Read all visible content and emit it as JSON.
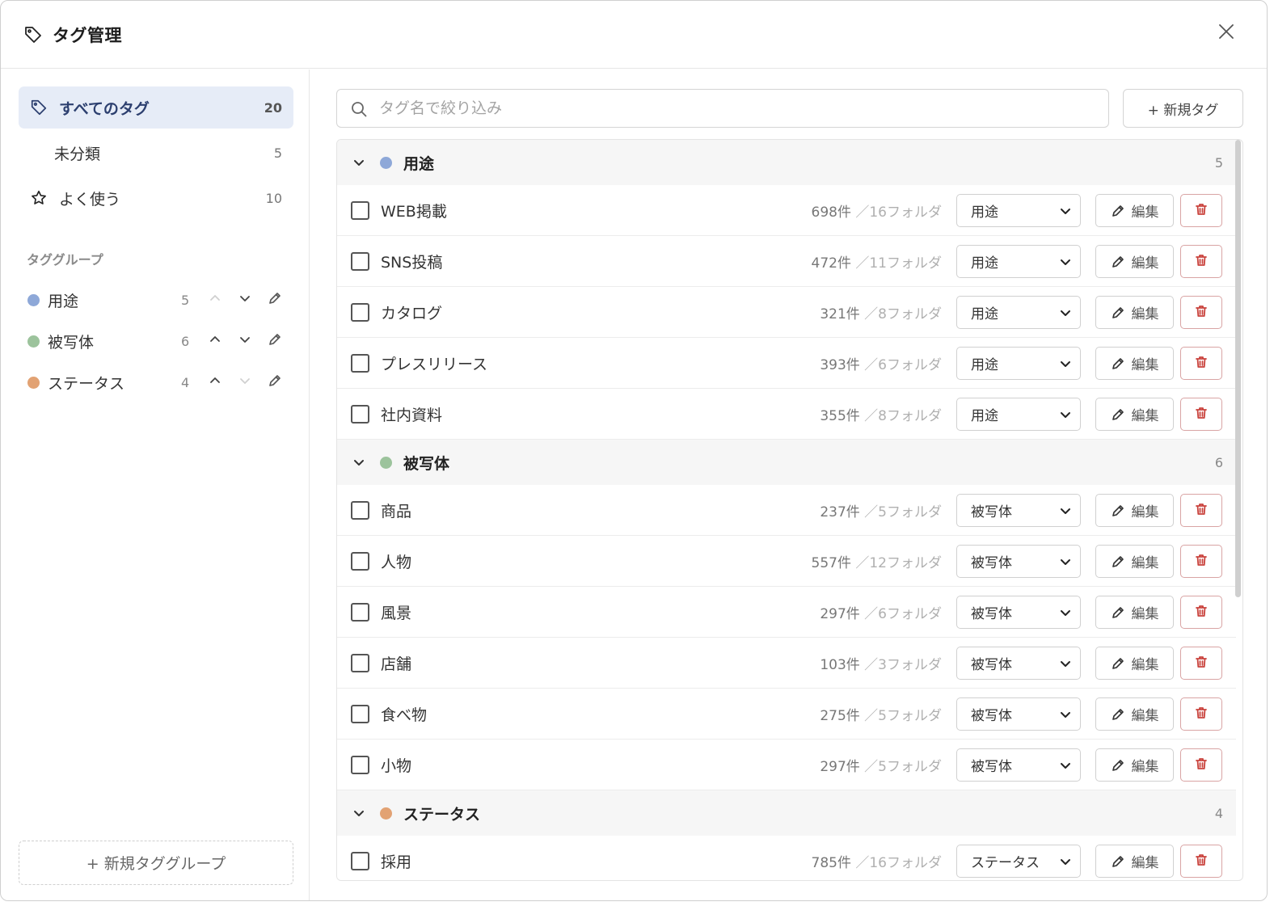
{
  "dialog": {
    "title": "タグ管理",
    "close_label": "閉じる"
  },
  "sidebar": {
    "nav": [
      {
        "label": "すべてのタグ",
        "count": "20",
        "icon": "tag-icon",
        "active": true
      },
      {
        "label": "未分類",
        "count": "5",
        "icon": "",
        "active": false
      },
      {
        "label": "よく使う",
        "count": "10",
        "icon": "star-icon",
        "active": false
      }
    ],
    "section_label": "タググループ",
    "groups": [
      {
        "label": "用途",
        "count": "5",
        "color": "#8ea8d8",
        "up_enabled": false,
        "down_enabled": true
      },
      {
        "label": "被写体",
        "count": "6",
        "color": "#9cc39c",
        "up_enabled": true,
        "down_enabled": true
      },
      {
        "label": "ステータス",
        "count": "4",
        "color": "#e2a273",
        "up_enabled": true,
        "down_enabled": false
      }
    ],
    "new_group_label": "+ 新規タググループ"
  },
  "toolbar": {
    "search_placeholder": "タグ名で絞り込み",
    "search_value": "",
    "new_tag_label": "+ 新規タグ"
  },
  "colors": {
    "accent": "#2c3f6f",
    "active_bg": "#e6ecf7",
    "danger": "#c9423c"
  },
  "list": {
    "edit_label": "編集",
    "groups": [
      {
        "label": "用途",
        "count": "5",
        "color": "#8ea8d8",
        "tags": [
          {
            "name": "WEB掲載",
            "items": "698件",
            "folders": "／16フォルダ",
            "group": "用途"
          },
          {
            "name": "SNS投稿",
            "items": "472件",
            "folders": "／11フォルダ",
            "group": "用途"
          },
          {
            "name": "カタログ",
            "items": "321件",
            "folders": "／8フォルダ",
            "group": "用途"
          },
          {
            "name": "プレスリリース",
            "items": "393件",
            "folders": "／6フォルダ",
            "group": "用途"
          },
          {
            "name": "社内資料",
            "items": "355件",
            "folders": "／8フォルダ",
            "group": "用途"
          }
        ]
      },
      {
        "label": "被写体",
        "count": "6",
        "color": "#9cc39c",
        "tags": [
          {
            "name": "商品",
            "items": "237件",
            "folders": "／5フォルダ",
            "group": "被写体"
          },
          {
            "name": "人物",
            "items": "557件",
            "folders": "／12フォルダ",
            "group": "被写体"
          },
          {
            "name": "風景",
            "items": "297件",
            "folders": "／6フォルダ",
            "group": "被写体"
          },
          {
            "name": "店舗",
            "items": "103件",
            "folders": "／3フォルダ",
            "group": "被写体"
          },
          {
            "name": "食べ物",
            "items": "275件",
            "folders": "／5フォルダ",
            "group": "被写体"
          },
          {
            "name": "小物",
            "items": "297件",
            "folders": "／5フォルダ",
            "group": "被写体"
          }
        ]
      },
      {
        "label": "ステータス",
        "count": "4",
        "color": "#e2a273",
        "tags": [
          {
            "name": "採用",
            "items": "785件",
            "folders": "／16フォルダ",
            "group": "ステータス"
          }
        ]
      }
    ]
  }
}
